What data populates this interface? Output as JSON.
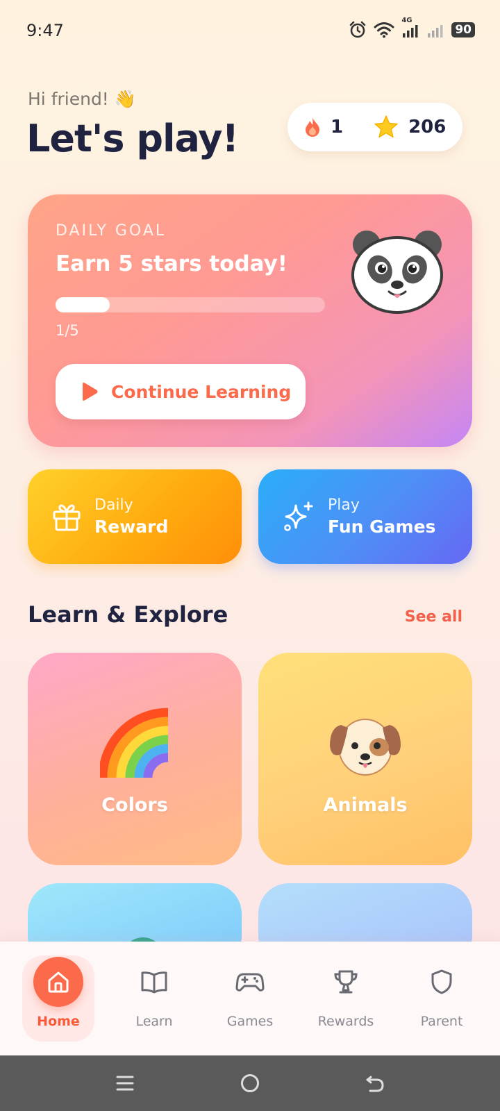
{
  "status_bar": {
    "time": "9:47",
    "network": "4G",
    "battery": "90"
  },
  "header": {
    "greeting": "Hi friend! 👋",
    "title": "Let's play!"
  },
  "stats": {
    "streak": "1",
    "streak_icon": "flame-icon",
    "stars": "206",
    "stars_icon": "star-icon"
  },
  "daily_goal": {
    "eyebrow": "DAILY GOAL",
    "title": "Earn 5 stars today!",
    "progress_text": "1/5",
    "progress_fraction": 0.2,
    "button_label": "Continue Learning",
    "mascot": "panda"
  },
  "quick_actions": [
    {
      "small": "Daily",
      "big": "Reward",
      "icon": "gift-icon"
    },
    {
      "small": "Play",
      "big": "Fun Games",
      "icon": "sparkle-icon"
    }
  ],
  "section": {
    "title": "Learn & Explore",
    "see_all": "See all"
  },
  "categories": [
    {
      "label": "Colors",
      "icon": "rainbow-icon"
    },
    {
      "label": "Animals",
      "icon": "dog-icon"
    }
  ],
  "bottom_nav": [
    {
      "label": "Home",
      "icon": "home-icon",
      "active": true
    },
    {
      "label": "Learn",
      "icon": "book-icon",
      "active": false
    },
    {
      "label": "Games",
      "icon": "gamepad-icon",
      "active": false
    },
    {
      "label": "Rewards",
      "icon": "trophy-icon",
      "active": false
    },
    {
      "label": "Parent",
      "icon": "shield-icon",
      "active": false
    }
  ],
  "colors": {
    "accent": "#fb6a4a",
    "title": "#1f2340",
    "reward_tile": "#ffa90e",
    "games_tile": "#4f8ef6"
  }
}
